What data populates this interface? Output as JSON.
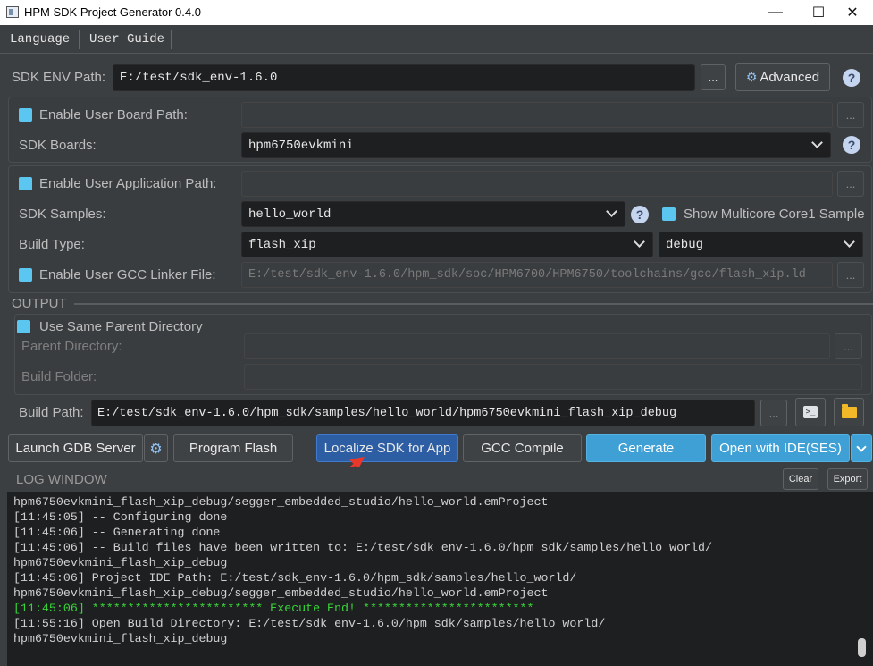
{
  "window": {
    "title": "HPM SDK Project Generator 0.4.0",
    "controls": {
      "minimize": "—",
      "maximize": "☐",
      "close": "✕"
    }
  },
  "menu": {
    "items": [
      "Language",
      "User Guide"
    ]
  },
  "sdk_env": {
    "label": "SDK ENV Path:",
    "value": "E:/test/sdk_env-1.6.0",
    "browse": "...",
    "advanced": "Advanced",
    "help": "?"
  },
  "board": {
    "enable_user_board_label": "Enable User Board Path:",
    "user_board_value": "",
    "browse": "...",
    "sdk_boards_label": "SDK Boards:",
    "sdk_boards_value": "hpm6750evkmini",
    "help": "?"
  },
  "application": {
    "enable_user_app_label": "Enable User Application Path:",
    "user_app_value": "",
    "browse": "...",
    "sdk_samples_label": "SDK Samples:",
    "sdk_samples_value": "hello_world",
    "help": "?",
    "show_multicore_label": "Show Multicore Core1 Sample",
    "build_type_label": "Build Type:",
    "build_type_value": "flash_xip",
    "build_mode_value": "debug",
    "enable_gcc_linker_label": "Enable User GCC Linker File:",
    "gcc_linker_value": "E:/test/sdk_env-1.6.0/hpm_sdk/soc/HPM6700/HPM6750/toolchains/gcc/flash_xip.ld",
    "linker_browse": "..."
  },
  "output": {
    "section_title": "OUTPUT",
    "use_same_parent_label": "Use Same Parent Directory",
    "parent_dir_label": "Parent Directory:",
    "parent_dir_value": "",
    "parent_browse": "...",
    "build_folder_label": "Build Folder:",
    "build_folder_value": "",
    "build_path_label": "Build Path:",
    "build_path_value": "E:/test/sdk_env-1.6.0/hpm_sdk/samples/hello_world/hpm6750evkmini_flash_xip_debug",
    "build_path_browse": "..."
  },
  "actions": {
    "launch_gdb": "Launch GDB Server",
    "program_flash": "Program Flash",
    "localize_sdk": "Localize SDK for App",
    "gcc_compile": "GCC Compile",
    "generate": "Generate",
    "open_ide": "Open with IDE(SES)"
  },
  "log": {
    "title": "LOG WINDOW",
    "clear": "Clear",
    "export": "Export",
    "lines": [
      "hpm6750evkmini_flash_xip_debug/segger_embedded_studio/hello_world.emProject",
      "[11:45:05] -- Configuring done",
      "[11:45:06] -- Generating done",
      "[11:45:06] -- Build files have been written to: E:/test/sdk_env-1.6.0/hpm_sdk/samples/hello_world/",
      "hpm6750evkmini_flash_xip_debug",
      "[11:45:06] Project IDE Path: E:/test/sdk_env-1.6.0/hpm_sdk/samples/hello_world/",
      "hpm6750evkmini_flash_xip_debug/segger_embedded_studio/hello_world.emProject",
      "[11:45:06] ************************ Execute End! ************************",
      "[11:55:16] Open Build Directory: E:/test/sdk_env-1.6.0/hpm_sdk/samples/hello_world/",
      "hpm6750evkmini_flash_xip_debug"
    ],
    "highlight_color": "#38d538"
  },
  "colors": {
    "accent_blue": "#2d5ea3",
    "generate_teal": "#3ea0d5",
    "checkbox": "#5bc6f0",
    "annotation_arrow": "#e8372b"
  }
}
